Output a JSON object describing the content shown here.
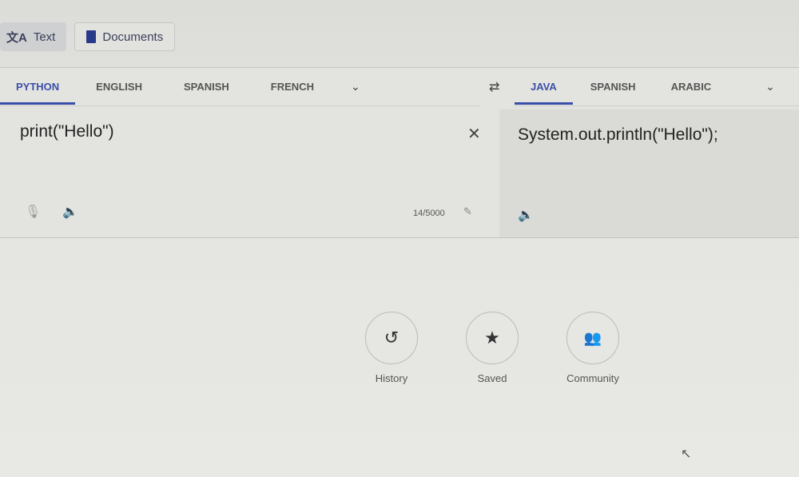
{
  "modes": [
    {
      "label": "Text",
      "icon": "translate-icon",
      "active": true
    },
    {
      "label": "Documents",
      "icon": "document-icon",
      "active": false
    }
  ],
  "source": {
    "languages": [
      "PYTHON",
      "ENGLISH",
      "SPANISH",
      "FRENCH"
    ],
    "active": "PYTHON",
    "text": "print(\"Hello\")",
    "char_count": "14/5000"
  },
  "target": {
    "languages": [
      "JAVA",
      "SPANISH",
      "ARABIC"
    ],
    "active": "JAVA",
    "text": "System.out.println(\"Hello\");"
  },
  "quick_actions": [
    {
      "label": "History",
      "icon": "history-icon"
    },
    {
      "label": "Saved",
      "icon": "star-icon"
    },
    {
      "label": "Community",
      "icon": "community-icon"
    }
  ],
  "accent_color": "#3b4fa8"
}
